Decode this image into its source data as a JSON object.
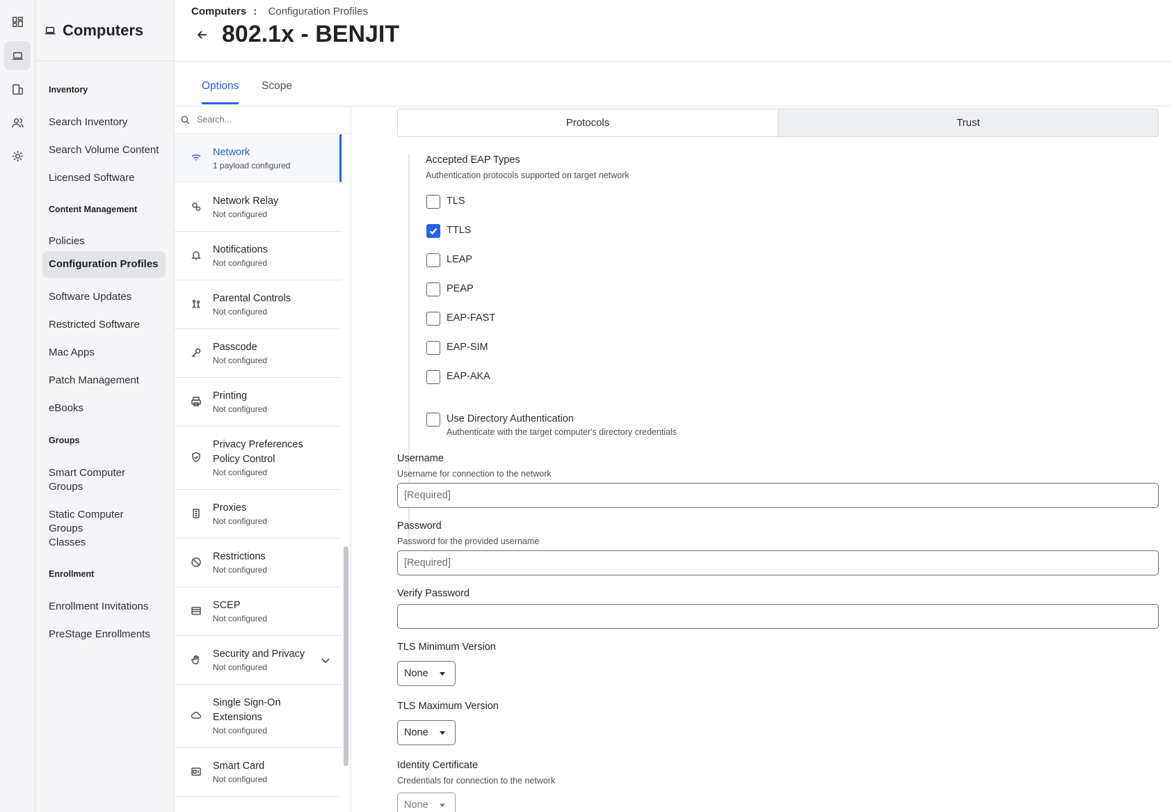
{
  "app": {
    "section_title": "Computers",
    "nav_rail": [
      {
        "icon": "dashboard-icon"
      },
      {
        "icon": "laptop-icon",
        "active": true
      },
      {
        "icon": "devices-icon"
      },
      {
        "icon": "users-icon"
      },
      {
        "icon": "gear-icon"
      }
    ]
  },
  "sidebar": {
    "groups": [
      {
        "heading": "Inventory",
        "items": [
          "Search Inventory",
          "Search Volume Content",
          "Licensed Software"
        ]
      },
      {
        "heading": "Content Management",
        "items": [
          "Policies",
          "Configuration Profiles",
          "Software Updates",
          "Restricted Software",
          "Mac Apps",
          "Patch Management",
          "eBooks"
        ]
      },
      {
        "heading": "Groups",
        "items": [
          "Smart Computer Groups",
          "Static Computer Groups",
          "Classes"
        ]
      },
      {
        "heading": "Enrollment",
        "items": [
          "Enrollment Invitations",
          "PreStage Enrollments"
        ]
      }
    ],
    "active_item": "Configuration Profiles"
  },
  "header": {
    "breadcrumb_root": "Computers",
    "breadcrumb_sep": ":",
    "breadcrumb_current": "Configuration Profiles",
    "title": "802.1x - BENJIT"
  },
  "tabs": [
    "Options",
    "Scope"
  ],
  "active_tab": "Options",
  "payload_list": {
    "search_placeholder": "Search...",
    "items": [
      {
        "name": "Network",
        "status": "1 payload configured",
        "icon": "wifi-icon",
        "active": true
      },
      {
        "name": "Network Relay",
        "status": "Not configured",
        "icon": "relay-icon"
      },
      {
        "name": "Notifications",
        "status": "Not configured",
        "icon": "bell-icon"
      },
      {
        "name": "Parental Controls",
        "status": "Not configured",
        "icon": "family-icon"
      },
      {
        "name": "Passcode",
        "status": "Not configured",
        "icon": "key-icon"
      },
      {
        "name": "Printing",
        "status": "Not configured",
        "icon": "printer-icon"
      },
      {
        "name": "Privacy Preferences Policy Control",
        "status": "Not configured",
        "icon": "shield-check-icon"
      },
      {
        "name": "Proxies",
        "status": "Not configured",
        "icon": "server-icon"
      },
      {
        "name": "Restrictions",
        "status": "Not configured",
        "icon": "block-icon"
      },
      {
        "name": "SCEP",
        "status": "Not configured",
        "icon": "card-icon"
      },
      {
        "name": "Security and Privacy",
        "status": "Not configured",
        "icon": "hand-icon",
        "expandable": true
      },
      {
        "name": "Single Sign-On Extensions",
        "status": "Not configured",
        "icon": "cloud-icon"
      },
      {
        "name": "Smart Card",
        "status": "Not configured",
        "icon": "smart-card-icon"
      }
    ]
  },
  "config": {
    "segments": [
      "Protocols",
      "Trust"
    ],
    "eap": {
      "label": "Accepted EAP Types",
      "hint": "Authentication protocols supported on target network",
      "types": [
        {
          "name": "TLS",
          "checked": false
        },
        {
          "name": "TTLS",
          "checked": true
        },
        {
          "name": "LEAP",
          "checked": false
        },
        {
          "name": "PEAP",
          "checked": false
        },
        {
          "name": "EAP-FAST",
          "checked": false
        },
        {
          "name": "EAP-SIM",
          "checked": false
        },
        {
          "name": "EAP-AKA",
          "checked": false
        }
      ],
      "directory_auth": {
        "label": "Use Directory Authentication",
        "hint": "Authenticate with the target computer's directory credentials",
        "checked": false
      }
    },
    "username": {
      "label": "Username",
      "hint": "Username for connection to the network",
      "placeholder": "[Required]",
      "value": ""
    },
    "password": {
      "label": "Password",
      "hint": "Password for the provided username",
      "placeholder": "[Required]",
      "value": ""
    },
    "verify_password": {
      "label": "Verify Password",
      "placeholder": "",
      "value": ""
    },
    "tls_min": {
      "label": "TLS Minimum Version",
      "value": "None"
    },
    "tls_max": {
      "label": "TLS Maximum Version",
      "value": "None"
    },
    "identity_cert": {
      "label": "Identity Certificate",
      "hint": "Credentials for connection to the network",
      "value": "None"
    }
  },
  "colors": {
    "accent": "#2563eb",
    "sidebar_bg": "#f5f5f7",
    "border": "#e3e4e8"
  }
}
